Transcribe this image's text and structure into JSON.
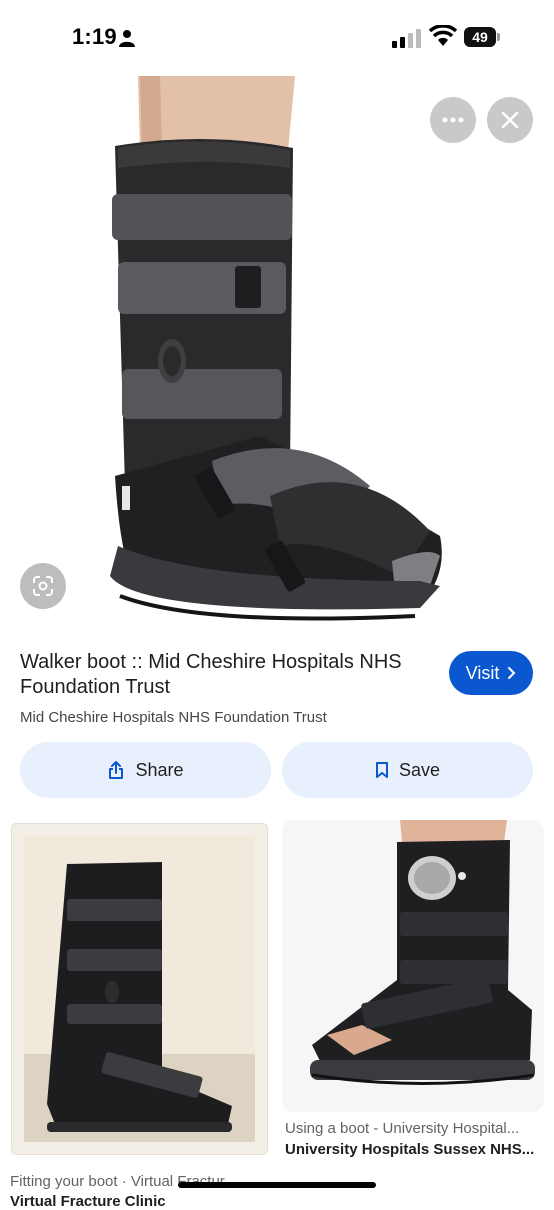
{
  "status_bar": {
    "time": "1:19",
    "battery": "49"
  },
  "image_viewer": {
    "more_icon": "ellipsis-icon",
    "close_icon": "close-icon",
    "lens_icon": "google-lens-icon"
  },
  "result": {
    "title": "Walker boot :: Mid Cheshire Hospitals NHS Foundation Trust",
    "source": "Mid Cheshire Hospitals NHS Foundation Trust",
    "visit_label": "Visit",
    "share_label": "Share",
    "save_label": "Save"
  },
  "related": [
    {
      "caption": "Fitting your boot · Virtual Fractur...",
      "source": "Virtual Fracture Clinic"
    },
    {
      "caption": "Using a boot - University Hospital...",
      "source": "University Hospitals Sussex NHS..."
    }
  ],
  "colors": {
    "accent": "#0b57d0",
    "pill_bg": "#e8f0fe"
  }
}
